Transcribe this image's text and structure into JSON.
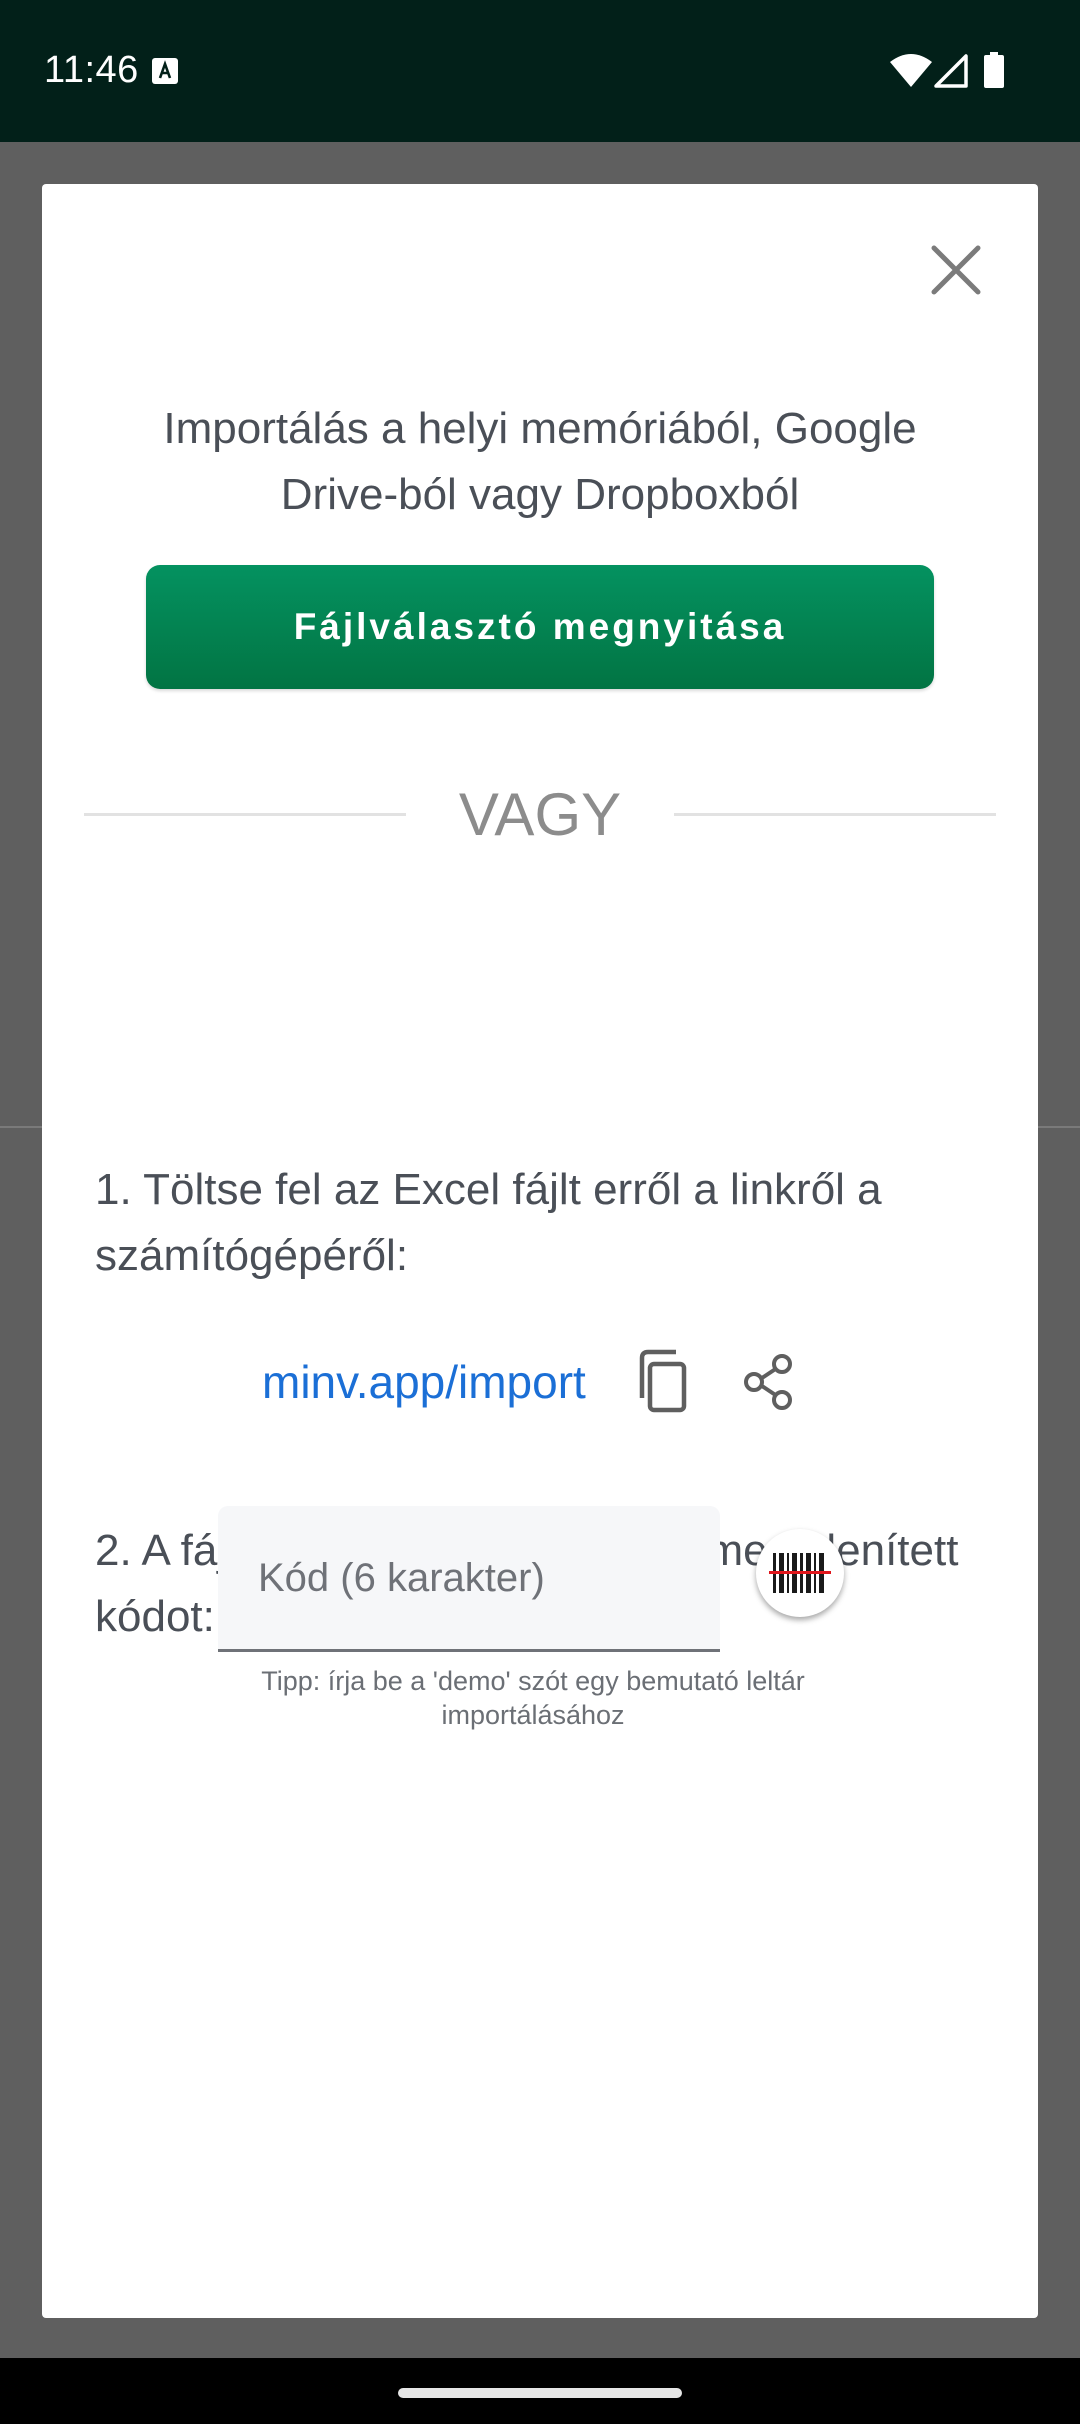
{
  "status_bar": {
    "time": "11:46",
    "icons": [
      "text-input-notification-icon",
      "wifi-icon",
      "cell-signal-icon",
      "battery-icon"
    ],
    "background_color": "#022019"
  },
  "dialog": {
    "title": "Importálás a helyi memóriából, Google Drive-ból vagy Dropboxból",
    "file_picker_button": "Fájlválasztó megnyitása",
    "file_picker_button_color": "#03844f",
    "or_text": "VAGY",
    "step1": "1. Töltse fel az Excel fájlt erről a linkről a számítógépéről:",
    "link": "minv.app/import",
    "link_color": "#1b6fd6",
    "step2": "2. A fájl feltöltése után írja be a megjelenített kódot:",
    "code_placeholder": "Kód (6 karakter)",
    "code_value": "",
    "tip": "Tipp: írja be a 'demo' szót egy bemutató leltár importálásához",
    "icons": [
      "close-icon",
      "copy-icon",
      "share-icon",
      "barcode-scanner-icon"
    ]
  }
}
